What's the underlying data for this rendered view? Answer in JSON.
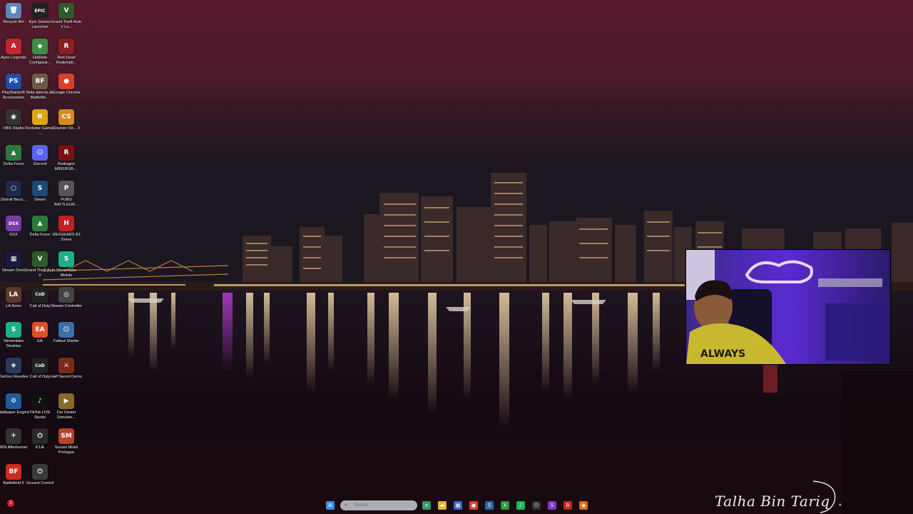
{
  "desktop": {
    "icons": [
      {
        "label": "Recycle Bin",
        "glyph": "🗑",
        "color": "#5a88b8",
        "icon": "recycle-bin-icon"
      },
      {
        "label": "Epic Games Launcher",
        "glyph": "EPIC",
        "color": "#222222",
        "icon": "epic-games-icon"
      },
      {
        "label": "Grand Theft Auto V Le...",
        "glyph": "V",
        "color": "#2f5a2a",
        "icon": "gta-v-icon"
      },
      {
        "label": "Apex Legends",
        "glyph": "A",
        "color": "#c0262d",
        "icon": "apex-legends-icon"
      },
      {
        "label": "HidHide Configurat...",
        "glyph": "◆",
        "color": "#3f8c4a",
        "icon": "hidhide-icon"
      },
      {
        "label": "Red Dead Redempti...",
        "glyph": "R",
        "color": "#8c1f1f",
        "icon": "red-dead-icon"
      },
      {
        "label": "PlayStation® Accessories",
        "glyph": "PS",
        "color": "#1f4fa8",
        "icon": "playstation-accessories-icon"
      },
      {
        "label": "Beta abierta de Battlefiel...",
        "glyph": "BF",
        "color": "#6a5a4a",
        "icon": "battlefield-beta-icon"
      },
      {
        "label": "Google Chrome",
        "glyph": "●",
        "color": "#d9402c",
        "icon": "chrome-icon"
      },
      {
        "label": "OBS Studio",
        "glyph": "◉",
        "color": "#333333",
        "icon": "obs-icon"
      },
      {
        "label": "Rockstar Games ...",
        "glyph": "R",
        "color": "#e0a419",
        "icon": "rockstar-icon"
      },
      {
        "label": "Counter-Str... 2",
        "glyph": "CS",
        "color": "#d48a1e",
        "icon": "counter-strike-icon"
      },
      {
        "label": "Delta Force",
        "glyph": "▲",
        "color": "#2b7a3b",
        "icon": "delta-force-icon"
      },
      {
        "label": "Discord",
        "glyph": "☺",
        "color": "#5865f2",
        "icon": "discord-icon"
      },
      {
        "label": "Redragon M991RGB-...",
        "glyph": "R",
        "color": "#7a1212",
        "icon": "redragon-icon"
      },
      {
        "label": "Detroit Beco...",
        "glyph": "○",
        "color": "#1e2a4a",
        "icon": "detroit-icon"
      },
      {
        "label": "Steam",
        "glyph": "S",
        "color": "#1b4a75",
        "icon": "steam-icon"
      },
      {
        "label": "PUBG BATTLEGR...",
        "glyph": "P",
        "color": "#555555",
        "icon": "pubg-icon"
      },
      {
        "label": "DSX",
        "glyph": "DSX",
        "color": "#7b3aa8",
        "icon": "dsx-icon"
      },
      {
        "label": "Delta Force",
        "glyph": "▲",
        "color": "#2b7a3b",
        "icon": "delta-force-icon-2"
      },
      {
        "label": "HEXGEARS A3 Driver",
        "glyph": "H",
        "color": "#c02020",
        "icon": "hexgears-icon"
      },
      {
        "label": "Stream Deck",
        "glyph": "▦",
        "color": "#1a1a40",
        "icon": "stream-deck-icon"
      },
      {
        "label": "Grand Theft Auto V",
        "glyph": "V",
        "color": "#2f5a2a",
        "icon": "gta-v-icon-2"
      },
      {
        "label": "Streamlabs Mobile",
        "glyph": "S",
        "color": "#1fae8a",
        "icon": "streamlabs-icon"
      },
      {
        "label": "LA Noire",
        "glyph": "LA",
        "color": "#5a3a2a",
        "icon": "la-noire-icon"
      },
      {
        "label": "Call of Duty",
        "glyph": "CoD",
        "color": "#222222",
        "icon": "call-of-duty-icon"
      },
      {
        "label": "Stream Controller",
        "glyph": "◎",
        "color": "#444444",
        "icon": "stream-controller-icon"
      },
      {
        "label": "Streamlabs Desktop",
        "glyph": "S",
        "color": "#1fae8a",
        "icon": "streamlabs-desktop-icon"
      },
      {
        "label": "EA",
        "glyph": "EA",
        "color": "#e14e2a",
        "icon": "ea-icon"
      },
      {
        "label": "Fallout Shelter",
        "glyph": "☺",
        "color": "#3a6fa8",
        "icon": "fallout-shelter-icon"
      },
      {
        "label": "DaVinci Resolve",
        "glyph": "◈",
        "color": "#2a3a5a",
        "icon": "davinci-resolve-icon"
      },
      {
        "label": "Call of Duty",
        "glyph": "CoD",
        "color": "#222222",
        "icon": "call-of-duty-icon-2"
      },
      {
        "label": "Half Sword Demo",
        "glyph": "⚔",
        "color": "#7a2a1a",
        "icon": "half-sword-icon"
      },
      {
        "label": "Wallpaper Engine",
        "glyph": "⚙",
        "color": "#1f5a9a",
        "icon": "wallpaper-engine-icon"
      },
      {
        "label": "TikTok LIVE Studio",
        "glyph": "♪",
        "color": "#111111",
        "icon": "tiktok-live-icon"
      },
      {
        "label": "Car Dealer Simulato...",
        "glyph": "▶",
        "color": "#8a6a2a",
        "icon": "car-dealer-icon"
      },
      {
        "label": "MSI Afterburner",
        "glyph": "✈",
        "color": "#333333",
        "icon": "msi-afterburner-icon"
      },
      {
        "label": "iCUE",
        "glyph": "⏻",
        "color": "#2a2a2a",
        "icon": "icue-icon"
      },
      {
        "label": "Sunset Motel Prologue",
        "glyph": "SM",
        "color": "#b8402a",
        "icon": "sunset-motel-icon"
      },
      {
        "label": "Battlefield 6",
        "glyph": "BF",
        "color": "#d02a1a",
        "icon": "battlefield-6-icon"
      },
      {
        "label": "Ground Control",
        "glyph": "⏻",
        "color": "#3a3a3a",
        "icon": "ground-control-icon"
      }
    ]
  },
  "taskbar": {
    "search_placeholder": "Search",
    "apps": [
      {
        "icon": "windows-start-icon",
        "glyph": "⊞",
        "color": "#3a8ee6"
      },
      {
        "icon": "task-view-icon",
        "glyph": "▣",
        "color": "#9aa3b0"
      },
      {
        "icon": "edge-icon",
        "glyph": "e",
        "color": "#2f9a6a"
      },
      {
        "icon": "file-explorer-icon",
        "glyph": "▬",
        "color": "#e6b43a"
      },
      {
        "icon": "store-icon",
        "glyph": "▦",
        "color": "#3a6ac8"
      },
      {
        "icon": "chrome-taskbar-icon",
        "glyph": "●",
        "color": "#d9402c"
      },
      {
        "icon": "steam-taskbar-icon",
        "glyph": "S",
        "color": "#2a6aa8"
      },
      {
        "icon": "xbox-icon",
        "glyph": "X",
        "color": "#2a9a3a"
      },
      {
        "icon": "spotify-icon",
        "glyph": "♪",
        "color": "#1db954"
      },
      {
        "icon": "icue-taskbar-icon",
        "glyph": "⏻",
        "color": "#333333"
      },
      {
        "icon": "streamlabs-taskbar-icon",
        "glyph": "S",
        "color": "#7a3ac8"
      },
      {
        "icon": "battlefield-taskbar-icon",
        "glyph": "B",
        "color": "#c02a1a"
      },
      {
        "icon": "obs-taskbar-icon",
        "glyph": "◉",
        "color": "#e06a1a"
      }
    ],
    "notification_count": "2"
  },
  "overlay": {
    "signature": "Talha Bin Tariq"
  },
  "colors": {
    "sky_top": "#5a1a2e",
    "water": "#160a10"
  }
}
